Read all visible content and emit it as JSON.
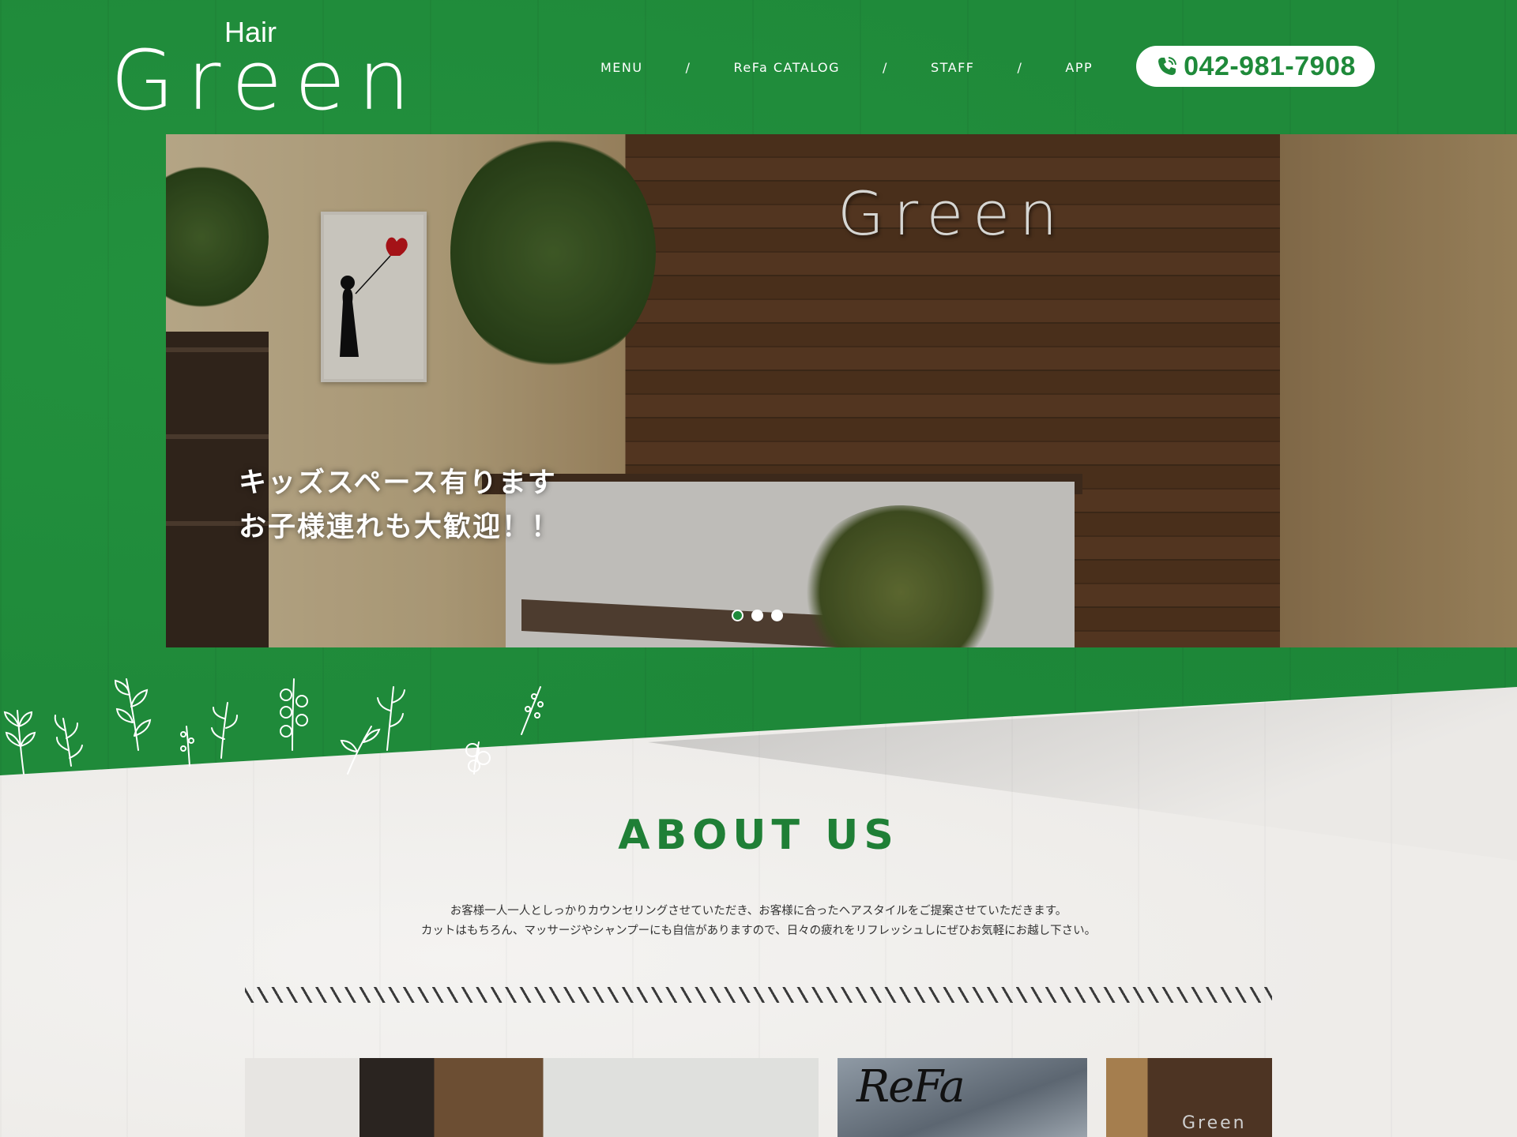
{
  "header": {
    "logo_small": "Hair",
    "logo_large": "Green",
    "nav": [
      {
        "label": "MENU"
      },
      {
        "label": "ReFa CATALOG"
      },
      {
        "label": "STAFF"
      },
      {
        "label": "APP"
      }
    ],
    "nav_separator": "/",
    "phone": "042-981-7908"
  },
  "hero": {
    "sign_text": "Green",
    "caption_line1": "キッズスペース有ります",
    "caption_line2": "お子様連れも大歓迎！！",
    "slide_count": 3,
    "active_slide": 1
  },
  "about": {
    "title": "ABOUT US",
    "text_line1": "お客様一人一人としっかりカウンセリングさせていただき、お客様に合ったヘアスタイルをご提案させていただきます。",
    "text_line2": "カットはもちろん、マッサージやシャンプーにも自信がありますので、日々の疲れをリフレッシュしにぜひお気軽にお越し下さい。"
  },
  "thumbnails": {
    "refa_logo": "ReFa",
    "sign_text": "Green"
  },
  "colors": {
    "brand_green": "#1f8a3a",
    "title_green": "#1f7f36",
    "paper": "#eeece9"
  }
}
